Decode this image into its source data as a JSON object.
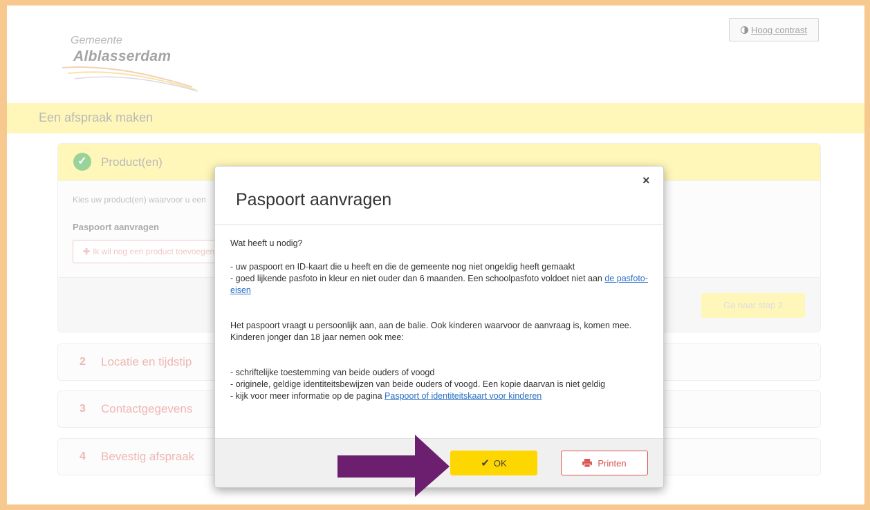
{
  "header": {
    "logo_line1": "Gemeente",
    "logo_line2": "Alblasserdam",
    "contrast_label": "Hoog contrast"
  },
  "page_title": "Een afspraak maken",
  "step1": {
    "title": "Product(en)",
    "instruction": "Kies uw product(en) waarvoor u een",
    "product": "Paspoort aanvragen",
    "add_button": "Ik wil nog een product toevoegen",
    "next_button": "Ga naar stap 2"
  },
  "steps": [
    {
      "num": "2",
      "label": "Locatie en tijdstip"
    },
    {
      "num": "3",
      "label": "Contactgegevens"
    },
    {
      "num": "4",
      "label": "Bevestig afspraak"
    }
  ],
  "modal": {
    "close": "×",
    "title": "Paspoort aanvragen",
    "question": "Wat heeft u nodig?",
    "req1": "- uw paspoort en ID-kaart die u heeft en die de gemeente nog niet ongeldig heeft gemaakt",
    "req2": "- goed lijkende pasfoto in kleur en niet ouder dan 6 maanden. Een schoolpasfoto voldoet niet aan",
    "req2_link": "de pasfoto-eisen",
    "para1": "Het paspoort vraagt u persoonlijk aan, aan de balie. Ook kinderen waarvoor de aanvraag is, komen mee.",
    "para2": "Kinderen jonger dan 18 jaar nemen ook mee:",
    "child1": "- schriftelijke toestemming van beide ouders of voogd",
    "child2": "- originele, geldige identiteitsbewijzen van beide ouders of voogd. Een kopie daarvan is niet geldig",
    "child3": "- kijk voor meer informatie op de pagina",
    "child3_link": "Paspoort of identiteitskaart voor kinderen",
    "ok_label": "OK",
    "print_label": "Printen"
  },
  "colors": {
    "yellow_band": "#fff28f",
    "ok_yellow": "#ffd700",
    "step_red": "#e58a84",
    "arrow_purple": "#6b1f6e",
    "frame_orange": "#f7c98e"
  }
}
